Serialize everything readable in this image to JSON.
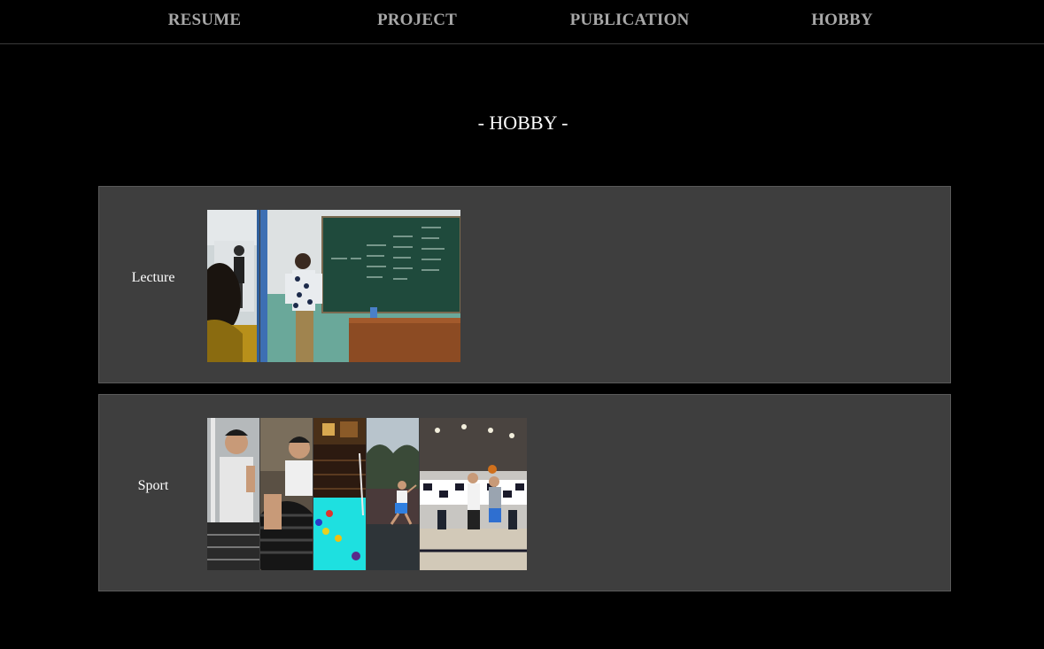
{
  "nav": {
    "items": [
      {
        "label": "RESUME"
      },
      {
        "label": "PROJECT"
      },
      {
        "label": "PUBLICATION"
      },
      {
        "label": "HOBBY"
      }
    ]
  },
  "page": {
    "title": "- HOBBY -"
  },
  "hobbies": [
    {
      "label": "Lecture",
      "photos": [
        "classroom-audience-photo",
        "lecture-chalkboard-photo"
      ]
    },
    {
      "label": "Sport",
      "photos": [
        "gym-selfie-photo",
        "gym-tire-photo",
        "billiards-photo",
        "outdoor-basketball-photo",
        "indoor-basketball-photo"
      ]
    }
  ],
  "colors": {
    "background": "#000000",
    "card": "#3e3e3e",
    "nav_text": "#a8a8a8",
    "title_text": "#ffffff"
  }
}
